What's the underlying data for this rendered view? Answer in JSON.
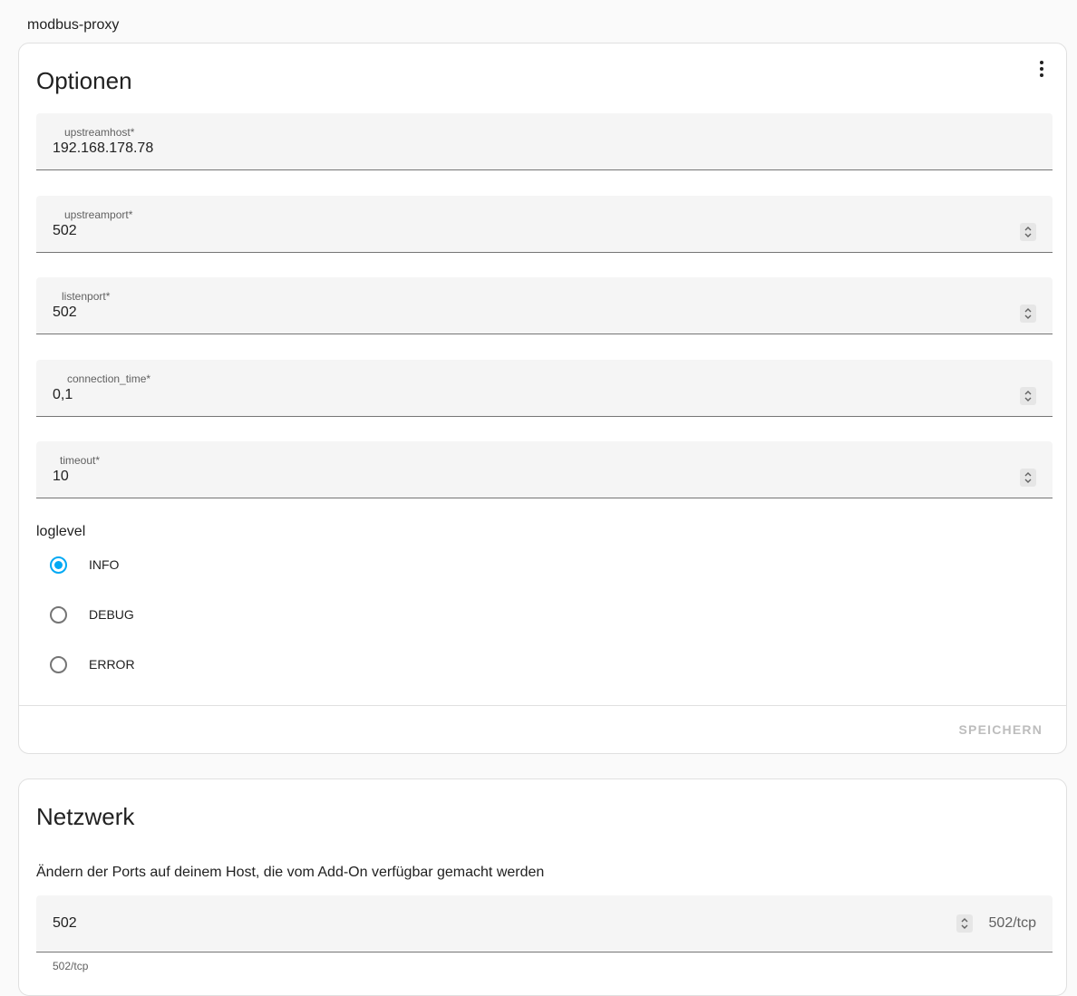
{
  "app": {
    "title": "modbus-proxy"
  },
  "options": {
    "title": "Optionen",
    "fields": [
      {
        "label": "upstreamhost*",
        "value": "192.168.178.78",
        "type": "text"
      },
      {
        "label": "upstreamport*",
        "value": "502",
        "type": "number"
      },
      {
        "label": "listenport*",
        "value": "502",
        "type": "number"
      },
      {
        "label": "connection_time*",
        "value": "0,1",
        "type": "number"
      },
      {
        "label": "timeout*",
        "value": "10",
        "type": "number"
      }
    ],
    "loglevel": {
      "label": "loglevel",
      "options": [
        {
          "label": "INFO",
          "checked": true
        },
        {
          "label": "DEBUG",
          "checked": false
        },
        {
          "label": "ERROR",
          "checked": false
        }
      ]
    },
    "save_label": "SPEICHERN"
  },
  "network": {
    "title": "Netzwerk",
    "description": "Ändern der Ports auf deinem Host, die vom Add-On verfügbar gemacht werden",
    "port": {
      "value": "502",
      "suffix": "502/tcp",
      "helper": "502/tcp"
    }
  },
  "colors": {
    "accent": "#03a9f4",
    "field_background": "#f5f5f5",
    "disabled_text": "#bdbdbd"
  }
}
